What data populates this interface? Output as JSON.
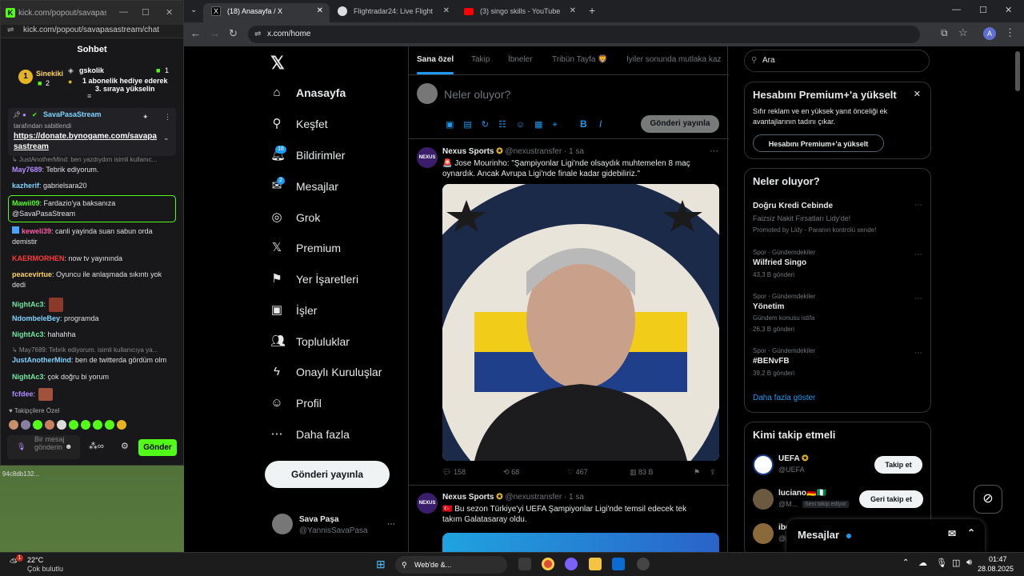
{
  "kick": {
    "tab_url": "kick.com/popout/savapasastre...",
    "url": "kick.com/popout/savapasastream/chat",
    "chat_title": "Sohbet",
    "leader": {
      "name": "Sinekiki",
      "rank": "1",
      "count": "2"
    },
    "gifter": {
      "name": "gskolik",
      "count": "1",
      "line1": "1 abonelik hediye ederek",
      "line2": "3. sıraya yükselin"
    },
    "pinned": {
      "user": "SavaPasaStream",
      "label": "tarafından sabitlendi",
      "link1": "https://donate.bynogame.com/savapa",
      "link2": "sastream"
    },
    "messages": [
      {
        "reply": "↳ JustAnotherMind: ben yazdıydım isimli kullanıc...",
        "user": "May7689",
        "text": ": Tebrik ediyorum.",
        "color": "#b58cff"
      },
      {
        "user": "kazherif",
        "text": ": gabrielsara20",
        "color": "#7ed4ff"
      },
      {
        "user": "Mawii09",
        "text": ": Fardazio'ya baksanıza @SavaPasaStream",
        "color": "#53fc18"
      },
      {
        "user": "keweli39",
        "text": ": canli yayinda suan sabun orda demistir",
        "color": "#ff5ba0"
      },
      {
        "user": "KAERMORHEN",
        "text": ": now tv yayınında",
        "color": "#ff3b3b"
      },
      {
        "user": "peacevirtue",
        "text": ": Oyuncu ile anlaşmada sıkıntı yok dedi",
        "color": "#ffd45b"
      },
      {
        "user": "NightAc3",
        "text": ":",
        "color": "#6ee7a0"
      },
      {
        "user": "NdombeleBey",
        "text": ": programda",
        "color": "#7ed4ff"
      },
      {
        "user": "NightAc3",
        "text": ": hahahha",
        "color": "#6ee7a0"
      },
      {
        "reply": "↳ May7689: Tebrik ediyorum. isimli kullanıcıya ya...",
        "user": "JustAnotherMind",
        "text": ": ben de twitterda gördüm olm",
        "color": "#7ed4ff"
      },
      {
        "user": "NightAc3",
        "text": ": çok doğru bi yorum",
        "color": "#6ee7a0"
      },
      {
        "user": "fcfdee",
        "text": ":",
        "color": "#b58cff"
      }
    ],
    "followers_label": "♥ Takipçilere Özel",
    "input_placeholder": "Bir mesaj gönderin",
    "send_label": "Gönder",
    "desktop_label": "94c8db132..."
  },
  "tabs": [
    {
      "label": "(18) Anasayfa / X",
      "icon_color": "#000000"
    },
    {
      "label": "Flightradar24: Live Flight Tracke",
      "icon_color": "#dddddd"
    },
    {
      "label": "(3) singo skills - YouTube",
      "icon_color": "#ff0000"
    }
  ],
  "url": "x.com/home",
  "nav": [
    {
      "label": "Anasayfa",
      "icon": "⌂",
      "name": "home"
    },
    {
      "label": "Keşfet",
      "icon": "⚲",
      "name": "explore"
    },
    {
      "label": "Bildirimler",
      "icon": "🔔︎",
      "name": "notifications",
      "badge": "16"
    },
    {
      "label": "Mesajlar",
      "icon": "✉",
      "name": "messages",
      "badge": "2"
    },
    {
      "label": "Grok",
      "icon": "◎",
      "name": "grok"
    },
    {
      "label": "Premium",
      "icon": "𝕏",
      "name": "premium"
    },
    {
      "label": "Yer İşaretleri",
      "icon": "⚑",
      "name": "bookmarks"
    },
    {
      "label": "İşler",
      "icon": "▣",
      "name": "jobs"
    },
    {
      "label": "Topluluklar",
      "icon": "👥︎",
      "name": "communities"
    },
    {
      "label": "Onaylı Kuruluşlar",
      "icon": "ϟ",
      "name": "verified-orgs"
    },
    {
      "label": "Profil",
      "icon": "☺",
      "name": "profile"
    },
    {
      "label": "Daha fazla",
      "icon": "⋯",
      "name": "more"
    }
  ],
  "post_button": "Gönderi yayınla",
  "profile": {
    "name": "Sava Paşa",
    "handle": "@YannisSavaPasa"
  },
  "feed_tabs": [
    "Sana özel",
    "Takip",
    "İbneler",
    "Tribün Tayfa 🦁",
    "İyiler sonunda mutlaka kaz"
  ],
  "compose": {
    "placeholder": "Neler oluyor?",
    "button": "Gönderi yayınla"
  },
  "tweet1": {
    "name": "Nexus Sports",
    "handle": "@nexustransfer · 1 sa",
    "text": "🚨 Jose Mourinho: \"Şampiyonlar Ligi'nde olsaydık muhtemelen 8 maç oynardık. Ancak Avrupa Ligi'nde finale kadar gidebiliriz.\"",
    "replies": "158",
    "retweets": "68",
    "likes": "467",
    "views": "83 B"
  },
  "tweet2": {
    "name": "Nexus Sports",
    "handle": "@nexustransfer · 1 sa",
    "text": "🇹🇷 Bu sezon Türkiye'yi UEFA Şampiyonlar Ligi'nde temsil edecek tek takım Galatasaray oldu."
  },
  "search_placeholder": "Ara",
  "premium": {
    "title": "Hesabını Premium+'a yükselt",
    "text": "Sıfır reklam ve en yüksek yanıt önceliği ek avantajlarının tadını çıkar.",
    "button": "Hesabını Premium+'a yükselt"
  },
  "trends_title": "Neler oluyor?",
  "trends": [
    {
      "category": "",
      "name": "Doğru Kredi Cebinde",
      "sub": "Faizsiz Nakit Fırsatları Lidy'de!",
      "extra": "Promoted by Lidy - Paranın kontrolü sende!"
    },
    {
      "category": "Spor · Gündemdekiler",
      "name": "Wilfried Singo",
      "sub": "43,3 B gönderi"
    },
    {
      "category": "Spor · Gündemdekiler",
      "name": "Yönetim",
      "sub": "26,3 B gönderi",
      "extra": "Gündem konusu istifa"
    },
    {
      "category": "Spor · Gündemdekiler",
      "name": "#BENvFB",
      "sub": "39,2 B gönderi"
    }
  ],
  "show_more": "Daha fazla göster",
  "who_to_follow": {
    "title": "Kimi takip etmeli",
    "accounts": [
      {
        "name": "UEFA",
        "handle": "@UEFA",
        "button": "Takip et"
      },
      {
        "name": "luciano🇩🇪🇳🇬",
        "handle": "@M...",
        "badge": "Seni takip ediyor",
        "button": "Geri takip et"
      },
      {
        "name": "ibo",
        "handle": "@p"
      }
    ]
  },
  "messages_drawer": "Mesajlar",
  "taskbar": {
    "temp": "22°C",
    "weather": "Çok bulutlu",
    "search": "Web'de &...",
    "time": "01:47",
    "date": "28.08.2025",
    "badge": "1"
  }
}
